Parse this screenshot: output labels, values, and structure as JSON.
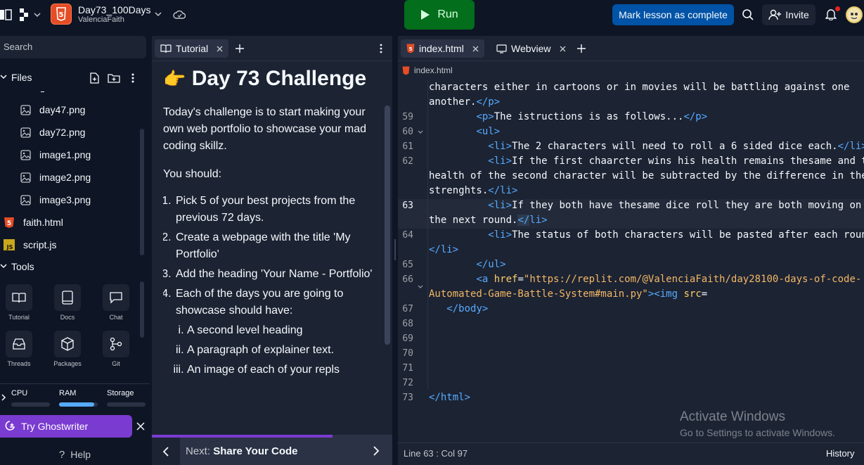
{
  "topbar": {
    "repl_name": "Day73_100Days",
    "repl_owner": "ValenciaFaith",
    "run_label": "Run",
    "mark_complete_label": "Mark lesson as complete",
    "invite_label": "Invite"
  },
  "sidebar": {
    "search_placeholder": "Search",
    "files_label": "Files",
    "files": [
      {
        "name": "day47.png",
        "icon": "image-file-icon"
      },
      {
        "name": "day72.png",
        "icon": "image-file-icon"
      },
      {
        "name": "image1.png",
        "icon": "image-file-icon"
      },
      {
        "name": "image2.png",
        "icon": "image-file-icon"
      },
      {
        "name": "image3.png",
        "icon": "image-file-icon"
      },
      {
        "name": "faith.html",
        "icon": "html-file-icon"
      },
      {
        "name": "script.js",
        "icon": "js-file-icon"
      }
    ],
    "tools_label": "Tools",
    "tools": [
      {
        "label": "Tutorial",
        "icon": "book-icon"
      },
      {
        "label": "Docs",
        "icon": "docs-icon"
      },
      {
        "label": "Chat",
        "icon": "chat-icon"
      },
      {
        "label": "Threads",
        "icon": "inbox-icon"
      },
      {
        "label": "Packages",
        "icon": "package-icon"
      },
      {
        "label": "Git",
        "icon": "git-icon"
      }
    ],
    "resources": {
      "cpu": "CPU",
      "ram": "RAM",
      "storage": "Storage",
      "ram_level": 0.9,
      "cpu_level": 0.0,
      "storage_level": 0.0
    },
    "ghostwriter_label": "Try Ghostwriter",
    "help_label": "Help"
  },
  "tutorial": {
    "tab_label": "Tutorial",
    "emoji": "👉",
    "title": "Day 73 Challenge",
    "intro": "Today's challenge is to start making your own web portfolio to showcase your mad coding skillz.",
    "you_should": "You should:",
    "steps": [
      "Pick 5 of your best projects from the previous 72 days.",
      "Create a webpage with the title 'My Portfolio'",
      "Add the heading 'Your Name - Portfolio'",
      "Each of the days you are going to showcase should have:"
    ],
    "substeps": [
      "A second level heading",
      "A paragraph of explainer text.",
      "An image of each of your repls"
    ],
    "next_prefix": "Next:",
    "next_title": "Share Your Code",
    "progress": 0.75
  },
  "editor": {
    "tab_file": "index.html",
    "tab_webview": "Webview",
    "breadcrumb": "index.html",
    "status_position": "Line 63 : Col 97",
    "history_label": "History",
    "lines": {
      "l58b": "characters either in cartoons or in movies will be battling against one",
      "l58c": "another.",
      "l59": "The istructions is as follows...",
      "l61": "The 2 characters will need to roll a 6 sided dice each.",
      "l62a": "If the first chaarcter wins his health remains thesame and the",
      "l62b": "health of the second character will be subtracted by the difference in their",
      "l62c": "strenghts.",
      "l63a": "If they both have thesame dice roll they are both moving on to",
      "l63b": "the next round.",
      "l64a": "The status of both characters will be pasted after each round.",
      "l66a_href": "\"https://replit.com/@ValenciaFaith/day28100-days-of-code-",
      "l66b_href": "Automated-Game-Battle-System#main.py\"",
      "nums": [
        "59",
        "60",
        "61",
        "62",
        "63",
        "64",
        "65",
        "66",
        "67",
        "68",
        "69",
        "70",
        "71",
        "72",
        "73"
      ]
    }
  },
  "watermark": {
    "line1": "Activate Windows",
    "line2": "Go to Settings to activate Windows."
  }
}
